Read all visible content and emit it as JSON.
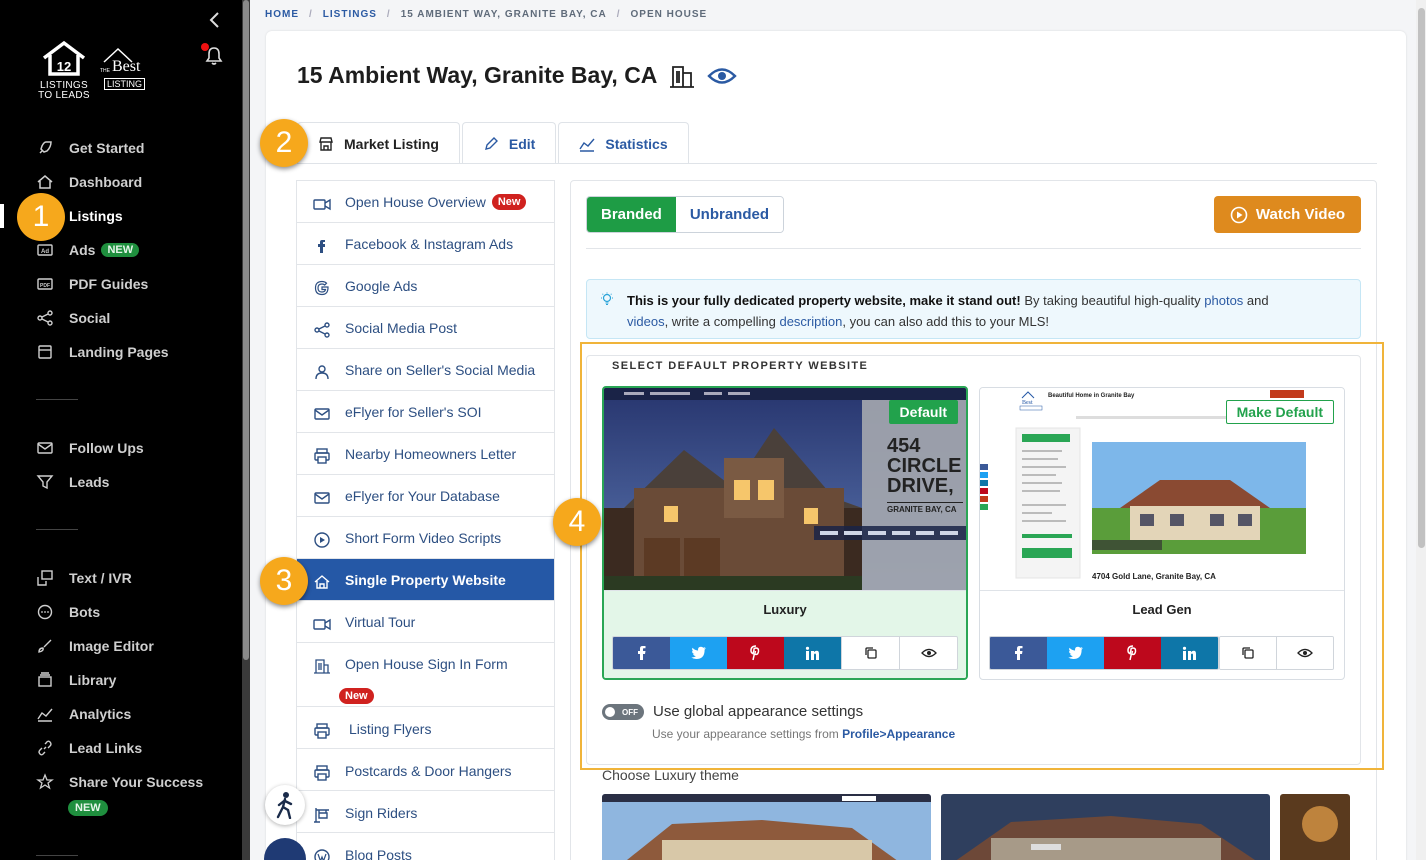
{
  "sidebar": {
    "logo1_line1": "LISTINGS",
    "logo1_line2": "TO LEADS",
    "logo2_small": "THE",
    "logo2_best": "Best",
    "logo2_listing": "LISTING",
    "items": [
      {
        "label": "Get Started",
        "icon": "rocket-icon"
      },
      {
        "label": "Dashboard",
        "icon": "home-icon"
      },
      {
        "label": "Listings",
        "icon": "listings-icon"
      },
      {
        "label": "Ads",
        "icon": "ad-icon",
        "badge": "NEW"
      },
      {
        "label": "PDF Guides",
        "icon": "pdf-icon"
      },
      {
        "label": "Social",
        "icon": "share-nodes-icon"
      },
      {
        "label": "Landing Pages",
        "icon": "browser-icon"
      },
      {
        "label": "Follow Ups",
        "icon": "envelope-icon"
      },
      {
        "label": "Leads",
        "icon": "funnel-icon"
      },
      {
        "label": "Text / IVR",
        "icon": "text-ivr-icon"
      },
      {
        "label": "Bots",
        "icon": "chat-bubble-icon"
      },
      {
        "label": "Image Editor",
        "icon": "brush-icon"
      },
      {
        "label": "Library",
        "icon": "layers-icon"
      },
      {
        "label": "Analytics",
        "icon": "chart-line-icon"
      },
      {
        "label": "Lead Links",
        "icon": "link-icon"
      },
      {
        "label": "Share Your Success",
        "icon": "star-icon",
        "badge": "NEW"
      }
    ]
  },
  "steps": [
    "1",
    "2",
    "3",
    "4"
  ],
  "breadcrumb": [
    "HOME",
    "/",
    "LISTINGS",
    "/",
    "15 AMBIENT WAY, GRANITE BAY, CA",
    "/",
    "OPEN HOUSE"
  ],
  "page_title": "15 Ambient Way, Granite Bay, CA",
  "tabs": [
    {
      "label": "Market Listing",
      "icon": "store-icon"
    },
    {
      "label": "Edit",
      "icon": "pencil-icon"
    },
    {
      "label": "Statistics",
      "icon": "chart-area-icon"
    }
  ],
  "menu": [
    {
      "label": "Open House Overview",
      "icon": "video-camera-icon",
      "badge": "New"
    },
    {
      "label": "Facebook & Instagram Ads",
      "icon": "facebook-icon"
    },
    {
      "label": "Google Ads",
      "icon": "google-icon"
    },
    {
      "label": "Social Media Post",
      "icon": "share-nodes-icon"
    },
    {
      "label": "Share on Seller's Social Media",
      "icon": "user-icon"
    },
    {
      "label": "eFlyer for Seller's SOI",
      "icon": "envelope-icon"
    },
    {
      "label": "Nearby Homeowners Letter",
      "icon": "printer-icon"
    },
    {
      "label": "eFlyer for Your Database",
      "icon": "envelope-icon"
    },
    {
      "label": "Short Form Video Scripts",
      "icon": "play-circle-icon"
    },
    {
      "label": "Single Property Website",
      "icon": "home-icon"
    },
    {
      "label": "Virtual Tour",
      "icon": "video-camera-icon"
    },
    {
      "label": "Open House Sign In Form",
      "icon": "building-icon",
      "badge": "New"
    },
    {
      "label": "Listing Flyers",
      "icon": "printer-icon"
    },
    {
      "label": "Postcards & Door Hangers",
      "icon": "printer-icon"
    },
    {
      "label": "Sign Riders",
      "icon": "sign-icon"
    },
    {
      "label": "Blog Posts",
      "icon": "wordpress-icon"
    }
  ],
  "panel": {
    "branded": "Branded",
    "unbranded": "Unbranded",
    "watch_video": "Watch Video",
    "info_bold": "This is your fully dedicated property website, make it stand out!",
    "info_a": " By taking beautiful high-quality ",
    "info_photos": "photos",
    "info_b": " and",
    "info_videos": "videos",
    "info_c": ", write a compelling ",
    "info_description": "description",
    "info_d": ", you can also add this to your MLS!",
    "legend": "SELECT DEFAULT PROPERTY WEBSITE",
    "luxury": {
      "name": "Luxury",
      "pill": "Default",
      "addr_l1": "454",
      "addr_l2": "CIRCLE",
      "addr_l3": "DRIVE,",
      "city": "GRANITE BAY, CA"
    },
    "leadgen": {
      "name": "Lead Gen",
      "pill": "Make Default",
      "heading": "Beautiful Home in Granite Bay",
      "caption": "4704 Gold Lane, Granite Bay, CA"
    },
    "toggle_state": "OFF",
    "toggle_label": "Use global appearance settings",
    "toggle_sub": "Use your appearance settings from ",
    "toggle_link": "Profile>Appearance",
    "choose_theme": "Choose Luxury theme"
  },
  "colors": {
    "sidebar_bg": "#000000",
    "accent_blue": "#2558a6",
    "branded_green": "#1e9c45",
    "watch_orange": "#de8a1e",
    "step_orange": "#f6a81c",
    "highlight_border": "#f0b43a"
  }
}
